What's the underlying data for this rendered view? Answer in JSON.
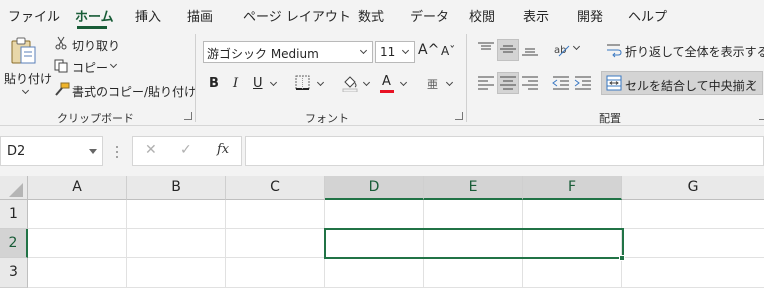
{
  "tabs": [
    "ファイル",
    "ホーム",
    "挿入",
    "描画",
    "ページ レイアウト",
    "数式",
    "データ",
    "校閲",
    "表示",
    "開発",
    "ヘルプ"
  ],
  "active_tab": "ホーム",
  "clipboard": {
    "paste_label": "貼り付け",
    "cut_label": "切り取り",
    "copy_label": "コピー",
    "format_painter_label": "書式のコピー/貼り付け",
    "group_label": "クリップボード"
  },
  "font": {
    "font_name": "游ゴシック Medium",
    "font_size": "11",
    "grow_icon": "A^",
    "shrink_icon": "Aˇ",
    "bold": "B",
    "italic": "I",
    "underline": "U",
    "font_color_glyph": "A",
    "phonetic_glyph": "亜",
    "group_label": "フォント",
    "font_color": "#e81123"
  },
  "alignment": {
    "wrap_text_label": "折り返して全体を表示する",
    "merge_center_label": "セルを結合して中央揃え",
    "group_label": "配置"
  },
  "formula_bar": {
    "name_box": "D2",
    "cancel_glyph": "✕",
    "enter_glyph": "✓",
    "fx_label": "fx",
    "formula": ""
  },
  "sheet": {
    "columns": [
      "A",
      "B",
      "C",
      "D",
      "E",
      "F",
      "G"
    ],
    "rows": [
      "1",
      "2",
      "3"
    ],
    "selected_range": "D2:F2",
    "accent_color": "#217346"
  }
}
